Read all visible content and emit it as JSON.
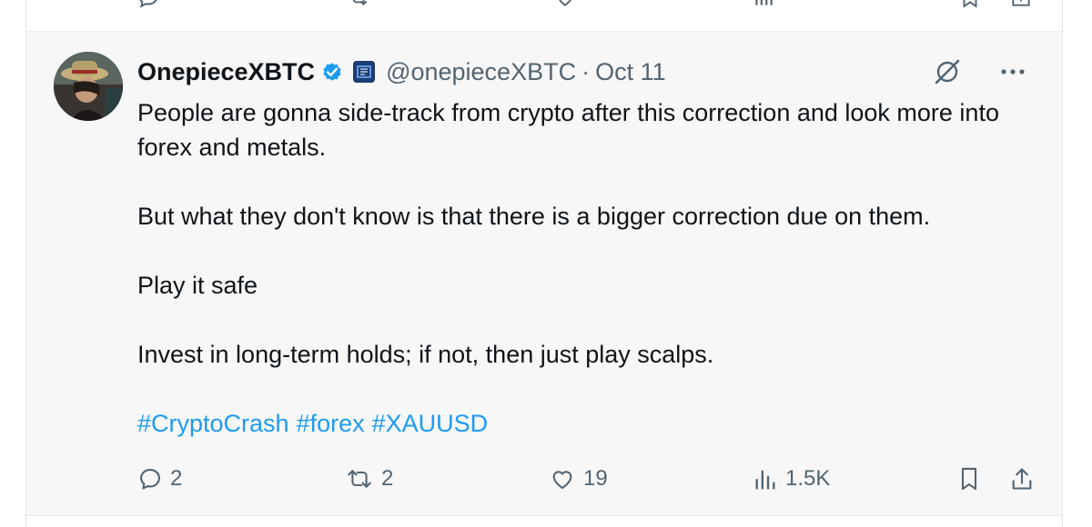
{
  "previous_tweet": {
    "actions": [
      "reply-icon",
      "retweet-icon",
      "like-icon",
      "views-icon",
      "bookmark-icon",
      "share-icon"
    ]
  },
  "tweet": {
    "author": {
      "display_name": "OnepieceXBTC",
      "handle": "@onepieceXBTC",
      "verified": true,
      "verified_color": "#1d9bf0",
      "affiliate_badge": "affiliate-badge-icon"
    },
    "separator": "·",
    "date": "Oct 11",
    "body": {
      "para1": "People are gonna side-track from crypto after this correction and look more into forex and metals.",
      "para2": "But what they don't know is that there is a bigger correction due on them.",
      "para3": "Play it safe",
      "para4": "Invest in long-term holds; if not, then just play scalps."
    },
    "hashtags": [
      "#CryptoCrash",
      "#forex",
      "#XAUUSD"
    ],
    "hashtag_color": "#1d9bf0",
    "stats": {
      "replies": "2",
      "reposts": "2",
      "likes": "19",
      "views": "1.5K"
    }
  },
  "colors": {
    "tweet_background": "#f7f7f7",
    "text": "#0f1419",
    "secondary_text": "#536471"
  }
}
